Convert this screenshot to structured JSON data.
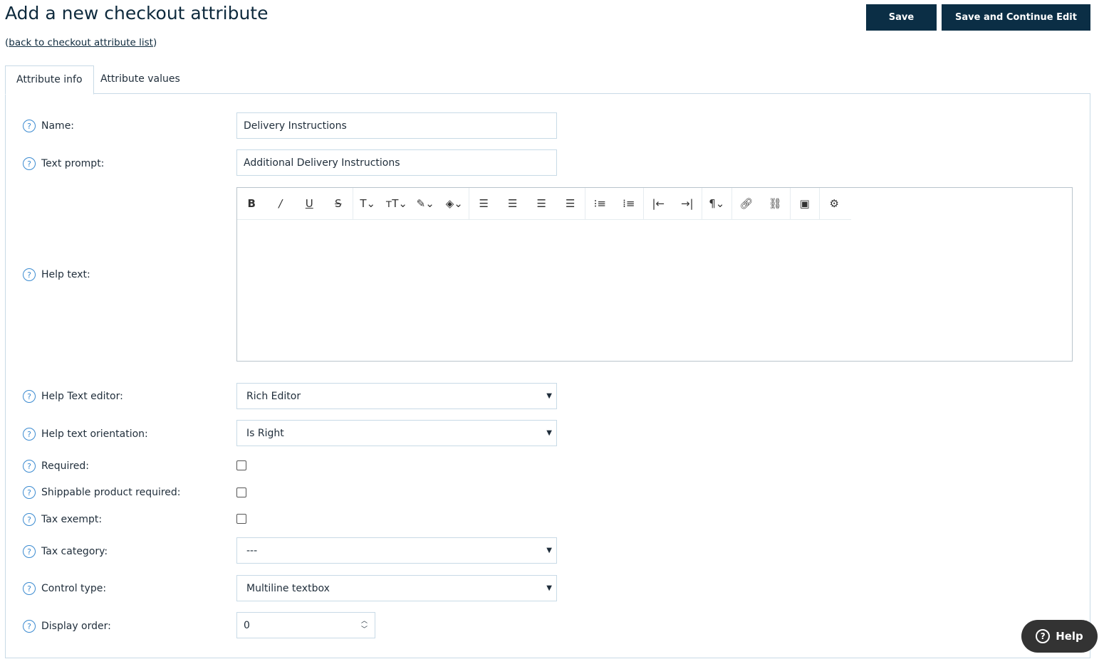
{
  "page": {
    "title": "Add a new checkout attribute",
    "back_link": "back to checkout attribute list"
  },
  "toolbar": {
    "save": "Save",
    "save_continue": "Save and Continue Edit"
  },
  "tabs": [
    "Attribute info",
    "Attribute values"
  ],
  "form": {
    "name": {
      "label": "Name:",
      "value": "Delivery Instructions"
    },
    "text_prompt": {
      "label": "Text prompt:",
      "value": "Additional Delivery Instructions"
    },
    "help_text": {
      "label": "Help text:",
      "value": ""
    },
    "help_text_editor": {
      "label": "Help Text editor:",
      "value": "Rich Editor"
    },
    "help_text_orientation": {
      "label": "Help text orientation:",
      "value": "Is Right"
    },
    "required": {
      "label": "Required:",
      "checked": false
    },
    "shippable": {
      "label": "Shippable product required:",
      "checked": false
    },
    "tax_exempt": {
      "label": "Tax exempt:",
      "checked": false
    },
    "tax_category": {
      "label": "Tax category:",
      "value": "---"
    },
    "control_type": {
      "label": "Control type:",
      "value": "Multiline textbox"
    },
    "display_order": {
      "label": "Display order:",
      "value": "0"
    }
  },
  "help_button": "Help"
}
